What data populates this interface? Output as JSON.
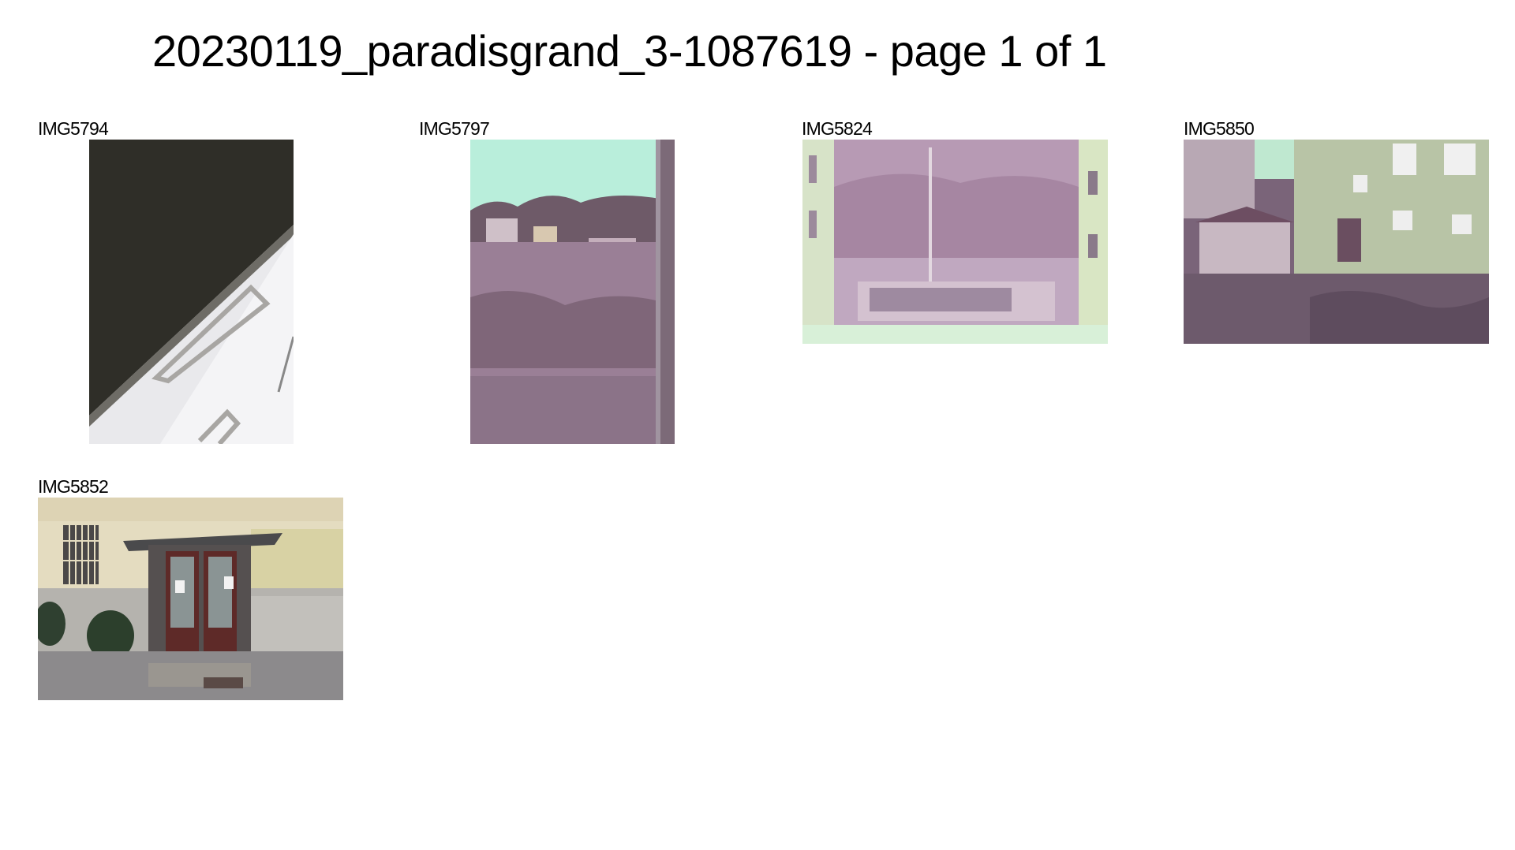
{
  "document": {
    "title": "20230119_paradisgrand_3-1087619 - page 1 of 1"
  },
  "thumbnails": [
    {
      "label": "IMG5794",
      "subject": "kitchen drawer handles under dark countertop"
    },
    {
      "label": "IMG5797",
      "subject": "view through window of trees and buildings"
    },
    {
      "label": "IMG5824",
      "subject": "courtyard view between apartment buildings"
    },
    {
      "label": "IMG5850",
      "subject": "backyard with shed and apartment building"
    },
    {
      "label": "IMG5852",
      "subject": "building entrance with double doors"
    }
  ]
}
